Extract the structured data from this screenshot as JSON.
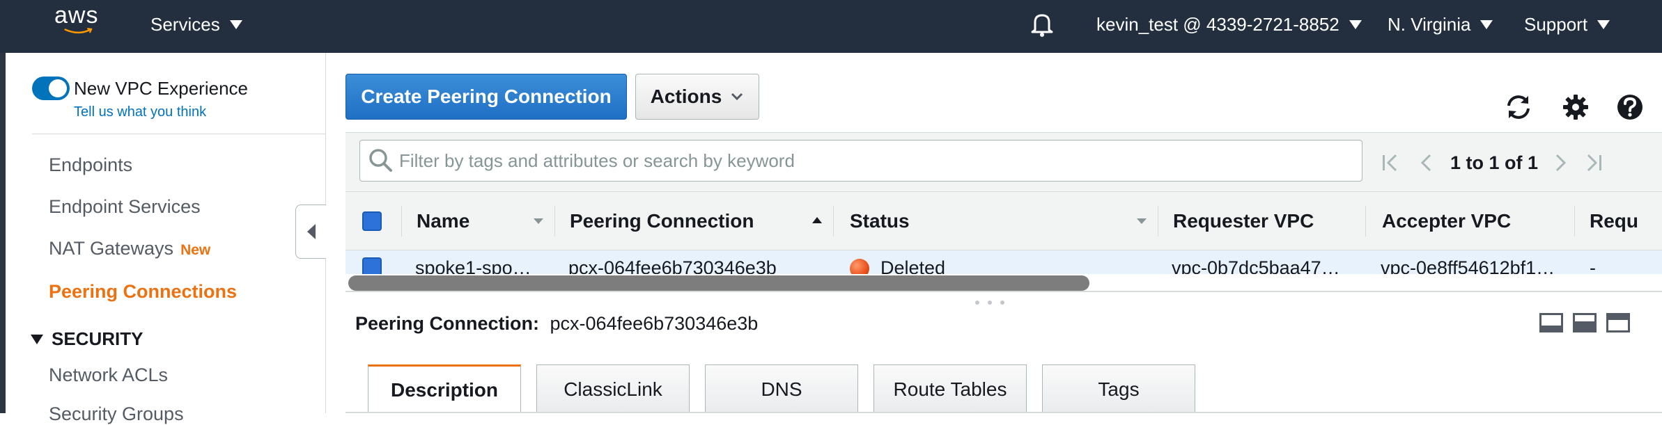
{
  "topbar": {
    "logo": "aws",
    "services": "Services",
    "account": "kevin_test @ 4339-2721-8852",
    "region": "N. Virginia",
    "support": "Support"
  },
  "sidebar": {
    "toggle_label": "New VPC Experience",
    "feedback_link": "Tell us what you think",
    "items": [
      {
        "label": "Endpoints"
      },
      {
        "label": "Endpoint Services"
      },
      {
        "label": "NAT Gateways",
        "badge": "New"
      },
      {
        "label": "Peering Connections",
        "active": true
      }
    ],
    "section": "SECURITY",
    "section_items": [
      {
        "label": "Network ACLs"
      },
      {
        "label": "Security Groups"
      }
    ]
  },
  "toolbar": {
    "create_label": "Create Peering Connection",
    "actions_label": "Actions"
  },
  "filter": {
    "placeholder": "Filter by tags and attributes or search by keyword",
    "pagination": "1 to 1 of 1"
  },
  "table": {
    "columns": [
      "Name",
      "Peering Connection",
      "Status",
      "Requester VPC",
      "Accepter VPC",
      "Requ"
    ],
    "rows": [
      {
        "name": "spoke1-spo…",
        "peering_connection": "pcx-064fee6b730346e3b",
        "status": "Deleted",
        "requester_vpc": "vpc-0b7dc5baa47…",
        "accepter_vpc": "vpc-0e8ff54612bf1…",
        "extra": "-"
      }
    ]
  },
  "detail": {
    "label": "Peering Connection:",
    "value": "pcx-064fee6b730346e3b",
    "tabs": [
      "Description",
      "ClassicLink",
      "DNS",
      "Route Tables",
      "Tags"
    ]
  },
  "colors": {
    "topbar": "#232f3e",
    "primary": "#1f6fc5",
    "accent": "#ec7211",
    "status_deleted": "#e8501b"
  }
}
